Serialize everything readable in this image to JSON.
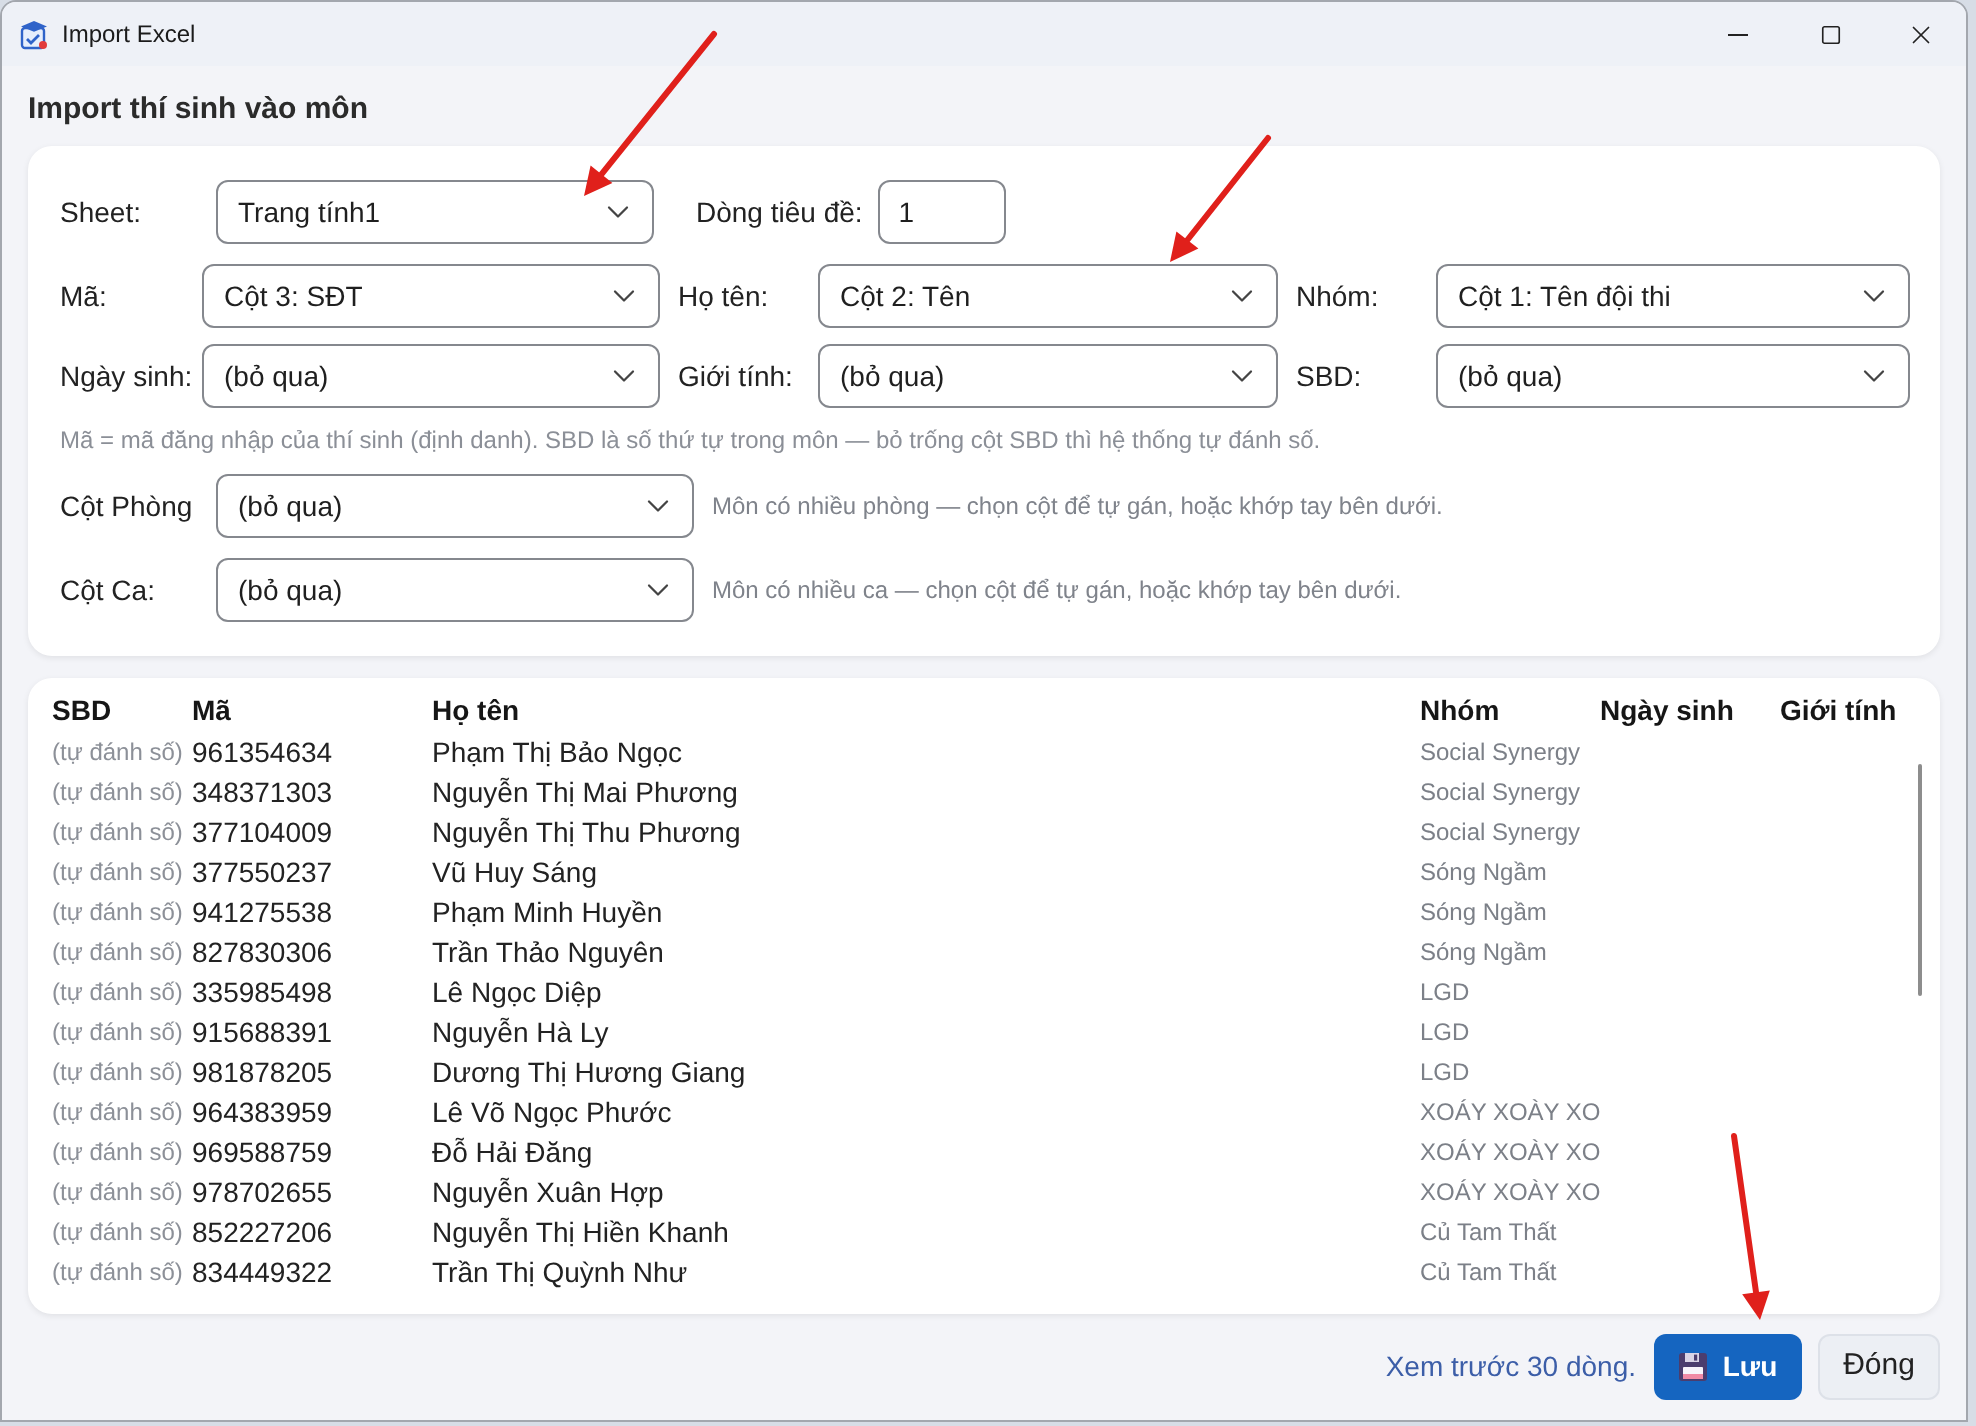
{
  "window": {
    "title": "Import Excel"
  },
  "heading": "Import thí sinh vào môn",
  "form": {
    "rows": [
      {
        "fields": [
          {
            "label": "Sheet:",
            "kind": "select",
            "value": "Trang tính1"
          },
          {
            "label": "Dòng tiêu đề:",
            "kind": "input",
            "value": "1"
          }
        ]
      },
      {
        "fields": [
          {
            "label": "Mã:",
            "kind": "select",
            "value": "Cột 3: SĐT"
          },
          {
            "label": "Họ tên:",
            "kind": "select",
            "value": "Cột 2: Tên"
          },
          {
            "label": "Nhóm:",
            "kind": "select",
            "value": "Cột 1: Tên đội thi"
          }
        ]
      },
      {
        "fields": [
          {
            "label": "Ngày sinh:",
            "kind": "select",
            "value": "(bỏ qua)"
          },
          {
            "label": "Giới tính:",
            "kind": "select",
            "value": "(bỏ qua)"
          },
          {
            "label": "SBD:",
            "kind": "select",
            "value": "(bỏ qua)"
          }
        ]
      }
    ],
    "note": "Mã = mã đăng nhập của thí sinh (định danh). SBD là số thứ tự trong môn — bỏ trống cột SBD thì hệ thống tự đánh số.",
    "column_rows": [
      {
        "label": "Cột Phòng",
        "value": "(bỏ qua)",
        "hint": "Môn có nhiều phòng — chọn cột để tự gán, hoặc khớp tay bên dưới."
      },
      {
        "label": "Cột Ca:",
        "value": "(bỏ qua)",
        "hint": "Môn có nhiều ca — chọn cột để tự gán, hoặc khớp tay bên dưới."
      }
    ]
  },
  "table": {
    "columns": [
      "SBD",
      "Mã",
      "Họ tên",
      "Nhóm",
      "Ngày sinh",
      "Giới tính"
    ],
    "rows": [
      [
        "(tự đánh số)",
        "961354634",
        "Phạm Thị Bảo Ngọc",
        "Social Synergy"
      ],
      [
        "(tự đánh số)",
        "348371303",
        "Nguyễn Thị Mai Phương",
        "Social Synergy"
      ],
      [
        "(tự đánh số)",
        "377104009",
        "Nguyễn Thị Thu Phương",
        "Social Synergy"
      ],
      [
        "(tự đánh số)",
        "377550237",
        "Vũ Huy Sáng",
        "Sóng Ngầm"
      ],
      [
        "(tự đánh số)",
        "941275538",
        "Phạm Minh Huyền",
        "Sóng Ngầm"
      ],
      [
        "(tự đánh số)",
        "827830306",
        "Trần Thảo Nguyên",
        "Sóng Ngầm"
      ],
      [
        "(tự đánh số)",
        "335985498",
        "Lê Ngọc Diệp",
        "LGD"
      ],
      [
        "(tự đánh số)",
        "915688391",
        "Nguyễn Hà Ly",
        "LGD"
      ],
      [
        "(tự đánh số)",
        "981878205",
        "Dương Thị Hương Giang",
        "LGD"
      ],
      [
        "(tự đánh số)",
        "964383959",
        "Lê Võ Ngọc Phước",
        "XOÁY XOÀY XO"
      ],
      [
        "(tự đánh số)",
        "969588759",
        "Đỗ Hải Đăng",
        "XOÁY XOÀY XO"
      ],
      [
        "(tự đánh số)",
        "978702655",
        "Nguyễn Xuân Hợp",
        "XOÁY XOÀY XO"
      ],
      [
        "(tự đánh số)",
        "852227206",
        "Nguyễn Thị Hiền Khanh",
        "Củ Tam Thất"
      ],
      [
        "(tự đánh số)",
        "834449322",
        "Trần Thị Quỳnh Như",
        "Củ Tam Thất"
      ]
    ]
  },
  "footer": {
    "status": "Xem trước 30 dòng.",
    "buttons": [
      {
        "label": "Lưu",
        "kind": "primary"
      },
      {
        "label": "Đóng",
        "kind": "secondary"
      }
    ]
  }
}
